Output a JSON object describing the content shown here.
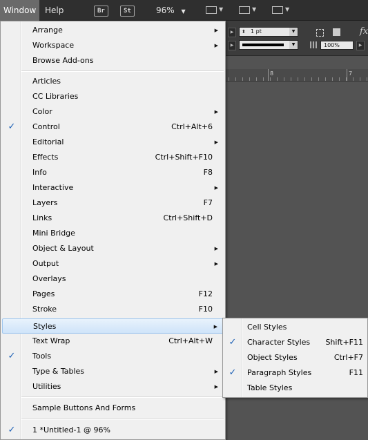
{
  "appbar": {
    "menus": [
      "Window",
      "Help"
    ],
    "bridge_label": "Br",
    "stock_label": "St",
    "zoom": "96%"
  },
  "control_panel": {
    "stroke_weight": "1 pt",
    "opacity": "100%",
    "fx_label": "fx."
  },
  "ruler": {
    "labels": [
      "8",
      "7"
    ]
  },
  "window_menu": {
    "items": [
      {
        "label": "Arrange",
        "shortcut": "",
        "checked": false,
        "submenu": true
      },
      {
        "label": "Workspace",
        "shortcut": "",
        "checked": false,
        "submenu": true
      },
      {
        "label": "Browse Add-ons",
        "shortcut": "",
        "checked": false,
        "submenu": false
      },
      {
        "label": "Articles",
        "shortcut": "",
        "checked": false,
        "submenu": false
      },
      {
        "label": "CC Libraries",
        "shortcut": "",
        "checked": false,
        "submenu": false
      },
      {
        "label": "Color",
        "shortcut": "",
        "checked": false,
        "submenu": true
      },
      {
        "label": "Control",
        "shortcut": "Ctrl+Alt+6",
        "checked": true,
        "submenu": false
      },
      {
        "label": "Editorial",
        "shortcut": "",
        "checked": false,
        "submenu": true
      },
      {
        "label": "Effects",
        "shortcut": "Ctrl+Shift+F10",
        "checked": false,
        "submenu": false
      },
      {
        "label": "Info",
        "shortcut": "F8",
        "checked": false,
        "submenu": false
      },
      {
        "label": "Interactive",
        "shortcut": "",
        "checked": false,
        "submenu": true
      },
      {
        "label": "Layers",
        "shortcut": "F7",
        "checked": false,
        "submenu": false
      },
      {
        "label": "Links",
        "shortcut": "Ctrl+Shift+D",
        "checked": false,
        "submenu": false
      },
      {
        "label": "Mini Bridge",
        "shortcut": "",
        "checked": false,
        "submenu": false
      },
      {
        "label": "Object & Layout",
        "shortcut": "",
        "checked": false,
        "submenu": true
      },
      {
        "label": "Output",
        "shortcut": "",
        "checked": false,
        "submenu": true
      },
      {
        "label": "Overlays",
        "shortcut": "",
        "checked": false,
        "submenu": false
      },
      {
        "label": "Pages",
        "shortcut": "F12",
        "checked": false,
        "submenu": false
      },
      {
        "label": "Stroke",
        "shortcut": "F10",
        "checked": false,
        "submenu": false
      },
      {
        "label": "Styles",
        "shortcut": "",
        "checked": false,
        "submenu": true
      },
      {
        "label": "Text Wrap",
        "shortcut": "Ctrl+Alt+W",
        "checked": false,
        "submenu": false
      },
      {
        "label": "Tools",
        "shortcut": "",
        "checked": true,
        "submenu": false
      },
      {
        "label": "Type & Tables",
        "shortcut": "",
        "checked": false,
        "submenu": true
      },
      {
        "label": "Utilities",
        "shortcut": "",
        "checked": false,
        "submenu": true
      },
      {
        "label": "Sample Buttons And Forms",
        "shortcut": "",
        "checked": false,
        "submenu": false
      },
      {
        "label": "1 *Untitled-1 @ 96%",
        "shortcut": "",
        "checked": true,
        "submenu": false
      }
    ]
  },
  "styles_submenu": {
    "items": [
      {
        "label": "Cell Styles",
        "shortcut": "",
        "checked": false
      },
      {
        "label": "Character Styles",
        "shortcut": "Shift+F11",
        "checked": true
      },
      {
        "label": "Object Styles",
        "shortcut": "Ctrl+F7",
        "checked": false
      },
      {
        "label": "Paragraph Styles",
        "shortcut": "F11",
        "checked": true
      },
      {
        "label": "Table Styles",
        "shortcut": "",
        "checked": false
      }
    ]
  },
  "glyphs": {
    "check": "✓",
    "submenu_arrow": "▶",
    "dropdown": "▼"
  },
  "colors": {
    "menu_bg": "#f0f0f0",
    "highlight": "#cfe4f9",
    "check": "#1b5fb5",
    "appbar_bg": "#2f2f2f",
    "canvas_bg": "#535353"
  }
}
